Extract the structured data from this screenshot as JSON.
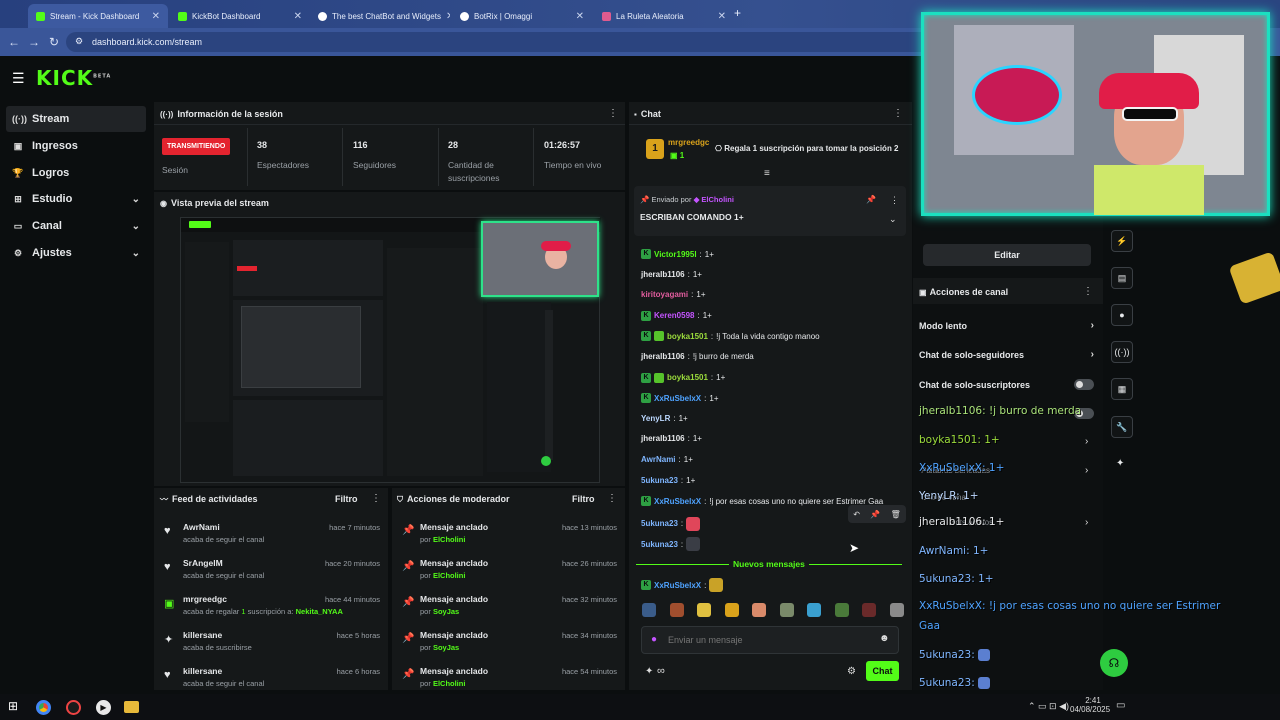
{
  "browser": {
    "tabs": [
      {
        "label": "Stream - Kick Dashboard",
        "color": "#53fc18"
      },
      {
        "label": "KickBot Dashboard",
        "color": "#53fc18"
      },
      {
        "label": "The best ChatBot and Widgets",
        "color": "#ffffff"
      },
      {
        "label": "BotRix | Omaggi",
        "color": "#ffffff"
      },
      {
        "label": "La Ruleta Aleatoria",
        "color": "#e05b8f"
      }
    ],
    "new_tab": "+",
    "url": "dashboard.kick.com/stream"
  },
  "kick": {
    "logo": "KICK",
    "beta": "BETA"
  },
  "sidebar": {
    "items": [
      {
        "label": "Stream",
        "icon": "radio-icon"
      },
      {
        "label": "Ingresos",
        "icon": "dollar-icon"
      },
      {
        "label": "Logros",
        "icon": "trophy-icon"
      },
      {
        "label": "Estudio",
        "icon": "studio-icon"
      },
      {
        "label": "Canal",
        "icon": "channel-icon"
      },
      {
        "label": "Ajustes",
        "icon": "gear-icon"
      }
    ]
  },
  "session": {
    "title": "Información de la sesión",
    "live_badge": "TRANSMITIENDO",
    "live_label": "Sesión",
    "stats": [
      {
        "value": "38",
        "label": "Espectadores"
      },
      {
        "value": "116",
        "label": "Seguidores"
      },
      {
        "value": "28",
        "label": "Cantidad de suscripciones"
      },
      {
        "value": "01:26:57",
        "label": "Tiempo en vivo"
      }
    ]
  },
  "preview": {
    "title": "Vista previa del stream"
  },
  "feed": {
    "title": "Feed de actividades",
    "filter": "Filtro",
    "items": [
      {
        "name": "AwrNami",
        "sub": "acaba de seguir el canal",
        "time": "hace 7 minutos",
        "icon": "heart-icon"
      },
      {
        "name": "SrAngelM",
        "sub": "acaba de seguir el canal",
        "time": "hace 20 minutos",
        "icon": "heart-icon"
      },
      {
        "name": "mrgreedgc",
        "sub": "acaba de regalar",
        "sub_count": "1",
        "sub_rest": "suscripción a:",
        "sub_target": "Nekita_NYAA",
        "time": "hace 44 minutos",
        "icon": "gift-icon"
      },
      {
        "name": "killersane",
        "sub": "acaba de suscribirse",
        "time": "hace 5 horas",
        "icon": "star-icon"
      },
      {
        "name": "killersane",
        "sub": "acaba de seguir el canal",
        "time": "hace 6 horas",
        "icon": "heart-icon"
      }
    ]
  },
  "modactions": {
    "title": "Acciones de moderador",
    "filter": "Filtro",
    "items": [
      {
        "title": "Mensaje anclado",
        "by": "por",
        "user": "ElCholini",
        "time": "hace 13 minutos"
      },
      {
        "title": "Mensaje anclado",
        "by": "por",
        "user": "ElCholini",
        "time": "hace 26 minutos"
      },
      {
        "title": "Mensaje anclado",
        "by": "por",
        "user": "SoyJas",
        "time": "hace 32 minutos"
      },
      {
        "title": "Mensaje anclado",
        "by": "por",
        "user": "SoyJas",
        "time": "hace 34 minutos"
      },
      {
        "title": "Mensaje anclado",
        "by": "por",
        "user": "ElCholini",
        "time": "hace 54 minutos"
      }
    ]
  },
  "chat": {
    "title": "Chat",
    "gift_rank": "1",
    "gift_user": "mrgreedgc",
    "gift_count": "1",
    "gift_text": "Regala 1 suscripción para tomar la posición 2",
    "pinned_by_label": "Enviado por",
    "pinned_user": "ElCholini",
    "pinned_text": "ESCRIBAN COMANDO 1+",
    "messages": [
      {
        "user": "Victor1995l",
        "text": "1+",
        "color": "#53fc18",
        "kbadge": true
      },
      {
        "user": "jheralb1106",
        "text": "1+",
        "color": "#e6e8ea"
      },
      {
        "user": "kiritoyagami",
        "text": "1+",
        "color": "#e25d9e"
      },
      {
        "user": "Keren0598",
        "text": "1+",
        "color": "#c454ff",
        "kbadge": true
      },
      {
        "user": "boyka1501",
        "text": "!j Toda la vida contigo manoo",
        "color": "#9bdc3c",
        "kbadge": true,
        "sbadge": true
      },
      {
        "user": "jheralb1106",
        "text": "!j burro de merda",
        "color": "#e6e8ea"
      },
      {
        "user": "boyka1501",
        "text": "1+",
        "color": "#9bdc3c",
        "kbadge": true,
        "sbadge": true
      },
      {
        "user": "XxRuSbelxX",
        "text": "1+",
        "color": "#4fa3ff",
        "kbadge": true
      },
      {
        "user": "YenyLR",
        "text": "1+",
        "color": "#bcd8ff"
      },
      {
        "user": "jheralb1106",
        "text": "1+",
        "color": "#e6e8ea"
      },
      {
        "user": "AwrNami",
        "text": "1+",
        "color": "#7fb6ff"
      },
      {
        "user": "5ukuna23",
        "text": "1+",
        "color": "#7fb6ff"
      },
      {
        "user": "XxRuSbelxX",
        "text": "!j por esas cosas uno no quiere ser Estrimer Gaa",
        "color": "#4fa3ff",
        "kbadge": true
      },
      {
        "user": "5ukuna23",
        "text": "",
        "color": "#7fb6ff"
      },
      {
        "user": "5ukuna23",
        "text": "",
        "color": "#7fb6ff"
      }
    ],
    "new_messages": "Nuevos mensajes",
    "last_msg_user": "XxRuSbelxX",
    "input_placeholder": "Enviar un mensaje",
    "send": "Chat",
    "infinity": "∞"
  },
  "right": {
    "edit": "Editar",
    "actions_title": "Acciones de canal",
    "rows": [
      "Modo lento",
      "Chat de solo-seguidores",
      "Chat de solo-suscriptores"
    ]
  },
  "overlay": {
    "lines": [
      {
        "user": "jheralb1106:",
        "text": "!j burro de merda",
        "color": "#a9e27a"
      },
      {
        "user": "boyka1501:",
        "text": "1+",
        "color": "#9bdc3c"
      },
      {
        "user": "XxRuSbelxX:",
        "text": "1+",
        "color": "#4fa3ff"
      },
      {
        "user": "YenyLR:",
        "text": "1+",
        "color": "#bcd8ff"
      },
      {
        "user": "jheralb1106:",
        "text": "1+",
        "color": "#e6e8ea"
      },
      {
        "user": "AwrNami:",
        "text": "1+",
        "color": "#7fb6ff"
      },
      {
        "user": "5ukuna23:",
        "text": "1+",
        "color": "#7fb6ff"
      },
      {
        "user": "XxRuSbelxX:",
        "text": "!j por esas cosas uno no quiere ser Estrimer",
        "color": "#4fa3ff"
      },
      {
        "user": "",
        "text": "Gaa",
        "color": "#4fa3ff"
      },
      {
        "user": "5ukuna23:",
        "text": "",
        "color": "#7fb6ff"
      },
      {
        "user": "5ukuna23:",
        "text": "",
        "color": "#7fb6ff"
      }
    ],
    "ghost_rows": [
      "Palabras baneadas",
      "Uso de canal",
      "Bots activos"
    ]
  },
  "taskbar": {
    "time": "2:41",
    "date": "04/08/2025"
  },
  "colors": {
    "kick_green": "#53fc18",
    "live_red": "#e4242f",
    "panel": "#151819",
    "bg": "#0b0e0f"
  }
}
